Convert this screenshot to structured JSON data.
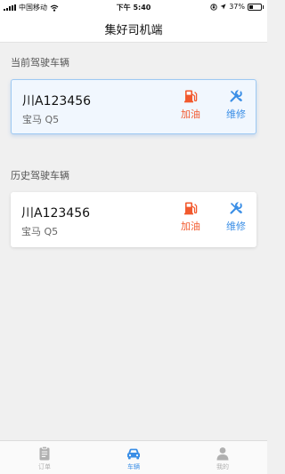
{
  "status_bar": {
    "carrier": "中国移动",
    "time": "下午 5:40",
    "battery": "37%",
    "battery_level": 0.37,
    "icons": [
      "signal-icon",
      "wifi-icon",
      "orientation-lock-icon",
      "location-icon",
      "battery-icon"
    ]
  },
  "nav": {
    "title": "集好司机端"
  },
  "current": {
    "section_title": "当前驾驶车辆",
    "vehicle": {
      "plate": "川A123456",
      "model": "宝马 Q5"
    },
    "actions": {
      "refuel": "加油",
      "repair": "维修"
    }
  },
  "history": {
    "section_title": "历史驾驶车辆",
    "vehicles": [
      {
        "plate": "川A123456",
        "model": "宝马 Q5"
      }
    ],
    "actions": {
      "refuel": "加油",
      "repair": "维修"
    }
  },
  "tabs": [
    {
      "label": "订单",
      "icon": "clipboard-icon",
      "active": false
    },
    {
      "label": "车辆",
      "icon": "car-icon",
      "active": true
    },
    {
      "label": "我的",
      "icon": "person-icon",
      "active": false
    }
  ],
  "colors": {
    "refuel": "#f25a2e",
    "repair": "#3a8ee6",
    "tab_active": "#3a8ee6",
    "tab_inactive": "#b0b0b0",
    "current_card_bg": "#f1f7fe",
    "current_card_border": "#9ec9f2"
  }
}
